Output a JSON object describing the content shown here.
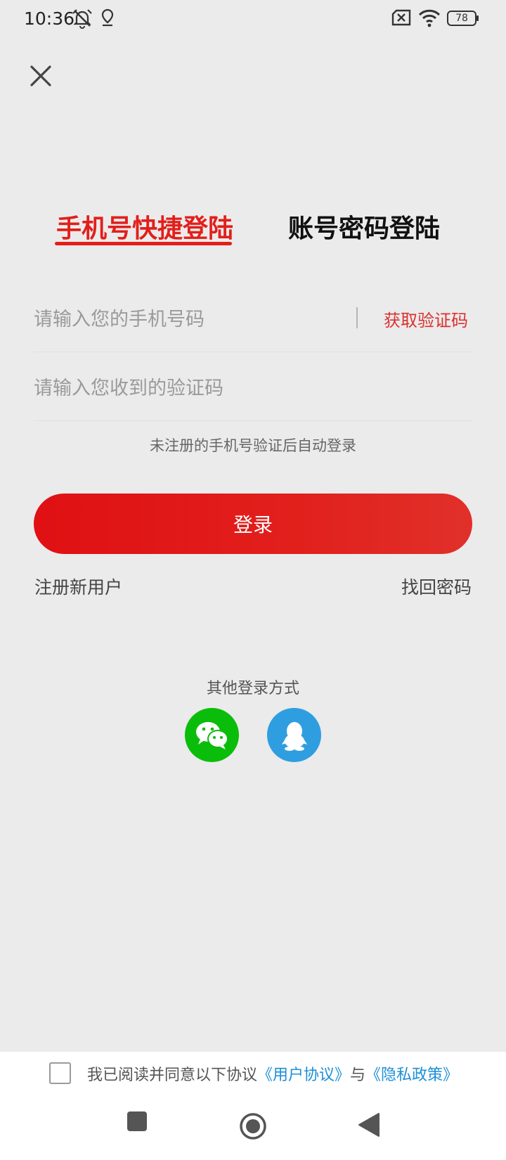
{
  "status_bar": {
    "time": "10:36",
    "battery": "78",
    "icons": [
      "alarm-off-icon",
      "location-icon",
      "sim-error-icon",
      "wifi-icon",
      "battery-icon"
    ]
  },
  "close_icon": "close-icon",
  "tabs": {
    "active_label": "手机号快捷登陆",
    "inactive_label": "账号密码登陆"
  },
  "form": {
    "phone_placeholder": "请输入您的手机号码",
    "get_code_label": "获取验证码",
    "code_placeholder": "请输入您收到的验证码",
    "hint": "未注册的手机号验证后自动登录",
    "login_label": "登录"
  },
  "links": {
    "register": "注册新用户",
    "forgot": "找回密码"
  },
  "other_login": {
    "title": "其他登录方式",
    "methods": [
      "wechat-icon",
      "qq-icon"
    ]
  },
  "agreement": {
    "prefix": "我已阅读并同意以下协议",
    "user_agreement": "《用户协议》",
    "joiner": "与",
    "privacy_policy": "《隐私政策》"
  },
  "nav_bar": {
    "icons": [
      "recents-icon",
      "home-icon",
      "back-icon"
    ]
  },
  "colors": {
    "accent": "#e21f1b",
    "background": "#ebebeb",
    "link_blue": "#1d8fd6",
    "wechat_green": "#0bbd0b",
    "qq_blue": "#2f9ee0"
  }
}
